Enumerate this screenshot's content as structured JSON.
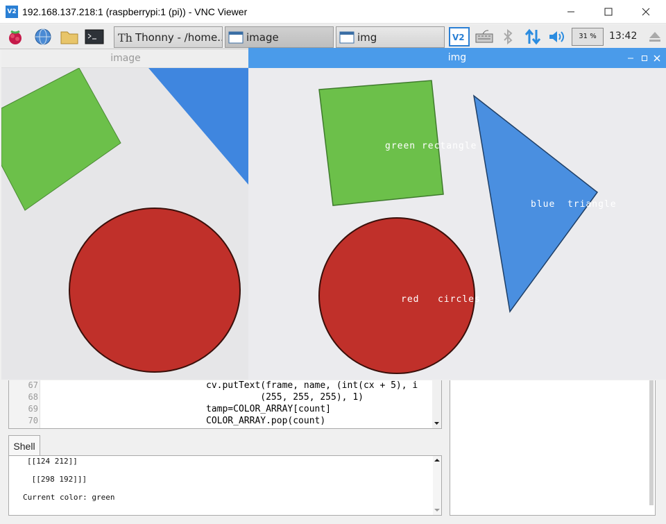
{
  "vnc": {
    "title": "192.168.137.218:1 (raspberrypi:1 (pi)) - VNC Viewer",
    "logo": "V2"
  },
  "panel": {
    "tasks": [
      {
        "label": "Thonny  -  /home...",
        "icon": "thonny-icon"
      },
      {
        "label": "image",
        "icon": "window-icon"
      },
      {
        "label": "img",
        "icon": "window-icon"
      }
    ],
    "cpu": "31 %",
    "clock": "13:42"
  },
  "windows": {
    "image_title": "image",
    "img_title": "img"
  },
  "labels": {
    "green": "green rectangle",
    "blue": "blue  triangle",
    "red": "red   circles"
  },
  "editor": {
    "lines": [
      {
        "num": "67",
        "code": "cv.putText(frame, name, (int(cx + 5), i"
      },
      {
        "num": "68",
        "code": "          (255, 255, 255), 1)"
      },
      {
        "num": "69",
        "code": "tamp=COLOR_ARRAY[count]"
      },
      {
        "num": "70",
        "code": "COLOR_ARRAY.pop(count)"
      }
    ]
  },
  "shell": {
    "tab": "Shell",
    "lines": [
      "[[124 212]]",
      " [[298 192]]]",
      "Current color: green"
    ]
  },
  "colors": {
    "accent": "#4a9bea",
    "green_shape": "#6cc04a",
    "blue_shape": "#3f86df",
    "red_shape": "#c0302a"
  }
}
